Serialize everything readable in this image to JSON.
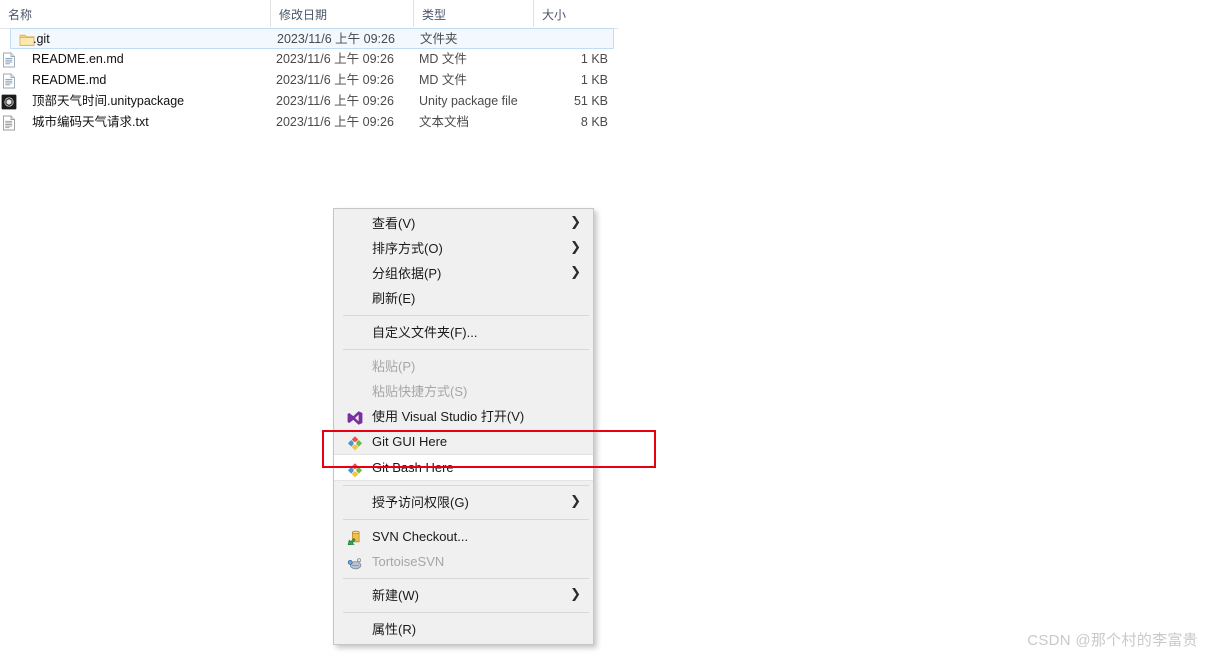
{
  "file_list": {
    "columns": [
      {
        "id": "name",
        "label": "名称",
        "sorted": true,
        "sort_direction": "ascending",
        "sort_glyph": "^"
      },
      {
        "id": "date",
        "label": "修改日期"
      },
      {
        "id": "type",
        "label": "类型"
      },
      {
        "id": "size",
        "label": "大小"
      }
    ],
    "rows": [
      {
        "name": ".git",
        "date": "2023/11/6 上午 09:26",
        "type": "文件夹",
        "size": "",
        "icon": "folder-icon",
        "selected": true
      },
      {
        "name": "README.en.md",
        "date": "2023/11/6 上午 09:26",
        "type": "MD 文件",
        "size": "1 KB",
        "icon": "md-file-icon",
        "selected": false
      },
      {
        "name": "README.md",
        "date": "2023/11/6 上午 09:26",
        "type": "MD 文件",
        "size": "1 KB",
        "icon": "md-file-icon",
        "selected": false
      },
      {
        "name": "顶部天气时间.unitypackage",
        "date": "2023/11/6 上午 09:26",
        "type": "Unity package file",
        "size": "51 KB",
        "icon": "unity-package-icon",
        "selected": false
      },
      {
        "name": "城市编码天气请求.txt",
        "date": "2023/11/6 上午 09:26",
        "type": "文本文档",
        "size": "8 KB",
        "icon": "text-file-icon",
        "selected": false
      }
    ]
  },
  "context_menu": {
    "items": [
      {
        "kind": "item",
        "label": "查看(V)",
        "icon": null,
        "submenu": true,
        "disabled": false,
        "hovered": false
      },
      {
        "kind": "item",
        "label": "排序方式(O)",
        "icon": null,
        "submenu": true,
        "disabled": false,
        "hovered": false
      },
      {
        "kind": "item",
        "label": "分组依据(P)",
        "icon": null,
        "submenu": true,
        "disabled": false,
        "hovered": false
      },
      {
        "kind": "item",
        "label": "刷新(E)",
        "icon": null,
        "submenu": false,
        "disabled": false,
        "hovered": false
      },
      {
        "kind": "separator"
      },
      {
        "kind": "item",
        "label": "自定义文件夹(F)...",
        "icon": null,
        "submenu": false,
        "disabled": false,
        "hovered": false
      },
      {
        "kind": "separator"
      },
      {
        "kind": "item",
        "label": "粘贴(P)",
        "icon": null,
        "submenu": false,
        "disabled": true,
        "hovered": false
      },
      {
        "kind": "item",
        "label": "粘贴快捷方式(S)",
        "icon": null,
        "submenu": false,
        "disabled": true,
        "hovered": false
      },
      {
        "kind": "item",
        "label": "使用 Visual Studio 打开(V)",
        "icon": "visual-studio-icon",
        "submenu": false,
        "disabled": false,
        "hovered": false
      },
      {
        "kind": "item",
        "label": "Git GUI Here",
        "icon": "git-icon",
        "submenu": false,
        "disabled": false,
        "hovered": false
      },
      {
        "kind": "item",
        "label": "Git Bash Here",
        "icon": "git-icon",
        "submenu": false,
        "disabled": false,
        "hovered": true
      },
      {
        "kind": "separator"
      },
      {
        "kind": "item",
        "label": "授予访问权限(G)",
        "icon": null,
        "submenu": true,
        "disabled": false,
        "hovered": false
      },
      {
        "kind": "separator"
      },
      {
        "kind": "item",
        "label": "SVN Checkout...",
        "icon": "svn-checkout-icon",
        "submenu": false,
        "disabled": false,
        "hovered": false
      },
      {
        "kind": "item",
        "label": "TortoiseSVN",
        "icon": "tortoise-svn-icon",
        "submenu": false,
        "disabled": true,
        "hovered": false
      },
      {
        "kind": "separator"
      },
      {
        "kind": "item",
        "label": "新建(W)",
        "icon": null,
        "submenu": true,
        "disabled": false,
        "hovered": false
      },
      {
        "kind": "separator"
      },
      {
        "kind": "item",
        "label": "属性(R)",
        "icon": null,
        "submenu": false,
        "disabled": false,
        "hovered": false
      }
    ],
    "submenu_glyph": "❯"
  },
  "highlight": {
    "target_label": "Git Bash Here",
    "color": "#e60012"
  },
  "watermark": {
    "text": "CSDN @那个村的李富贵"
  },
  "colors": {
    "selection_fill": "#f2f8fd",
    "selection_border": "#bfdef5",
    "menu_background": "#f0f0f0",
    "menu_border": "#c6c6c6",
    "hover_background": "#ffffff",
    "highlight_red": "#e60012",
    "header_text": "#4a5568"
  }
}
